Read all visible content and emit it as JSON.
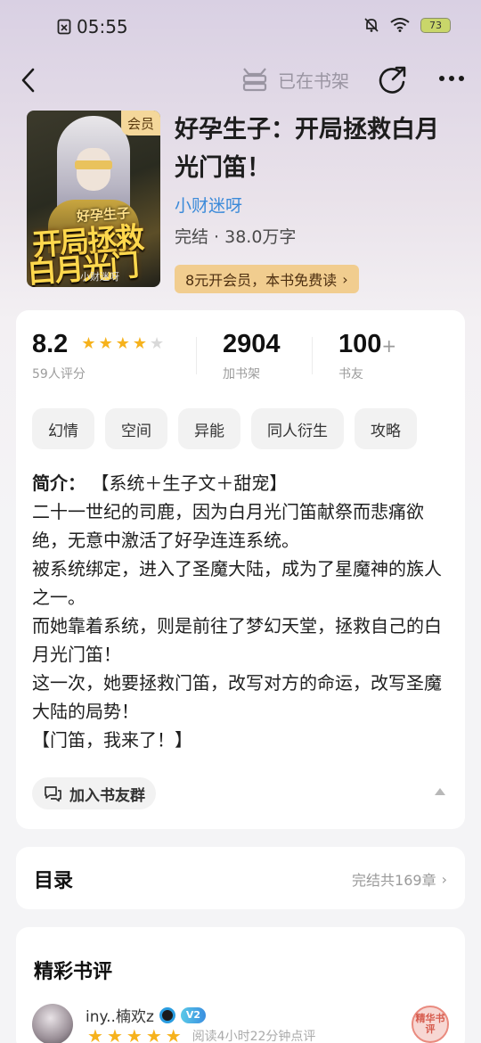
{
  "status_bar": {
    "time": "05:55",
    "battery": "73"
  },
  "nav": {
    "shelf_label": "已在书架"
  },
  "book": {
    "cover_badge": "会员",
    "cover_line1": "好孕生子",
    "cover_line2": "开局拯救",
    "cover_line3": "白月光门笛",
    "cover_author": "小财迷呀",
    "title": "好孕生子：开局拯救白月光门笛！",
    "author": "小财迷呀",
    "status_words": "完结 · 38.0万字",
    "vip_offer": "8元开会员，本书免费读"
  },
  "stats": {
    "rating": "8.2",
    "rating_label": "59人评分",
    "rating_stars": 4,
    "shelf_count": "2904",
    "shelf_label": "加书架",
    "friends_count": "100",
    "friends_suffix": "+",
    "friends_label": "书友"
  },
  "tags": [
    "幻情",
    "空间",
    "异能",
    "同人衍生",
    "攻略"
  ],
  "intro": {
    "label": "简介：",
    "first_line": "【系统＋生子文＋甜宠】",
    "paragraphs": [
      "二十一世纪的司鹿，因为白月光门笛献祭而悲痛欲绝，无意中激活了好孕连连系统。",
      "被系统绑定，进入了圣魔大陆，成为了星魔神的族人之一。",
      "而她靠着系统，则是前往了梦幻天堂，拯救自己的白月光门笛！",
      "这一次，她要拯救门笛，改写对方的命运，改写圣魔大陆的局势！",
      "【门笛，我来了！】"
    ]
  },
  "group_button": "加入书友群",
  "toc": {
    "title": "目录",
    "info": "完结共169章"
  },
  "reviews": {
    "title": "精彩书评",
    "first": {
      "username": "iny..楠欢z",
      "level": "V2",
      "stars": 5,
      "read_time": "阅读4小时22分钟点评",
      "badge": "精华书评"
    }
  },
  "colors": {
    "author_link": "#3b8ad9",
    "star": "#f6b21c",
    "vip_button": "#f1cd8f"
  }
}
